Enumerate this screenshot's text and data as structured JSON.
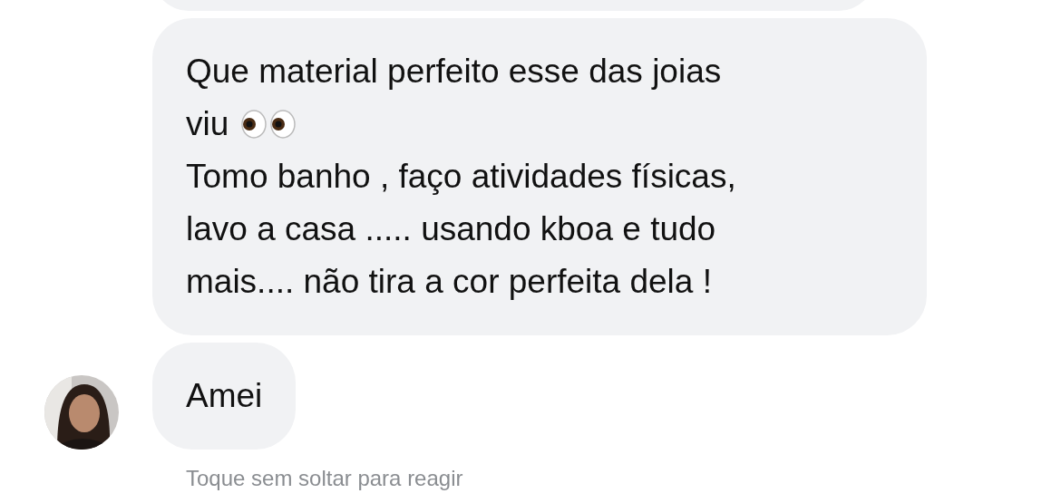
{
  "messages": [
    {
      "lines": [
        {
          "text": "Que material perfeito esse das joias"
        },
        {
          "text": "viu",
          "kind": "eyes"
        },
        {
          "text": "Tomo banho , faço atividades físicas,"
        },
        {
          "text": "lavo a casa ..... usando kboa e tudo"
        },
        {
          "text": "mais.... não tira a cor perfeita dela !"
        }
      ],
      "avatar": false
    },
    {
      "lines": [
        {
          "text": "Amei"
        }
      ],
      "avatar": true
    }
  ],
  "hint": "Toque sem soltar para reagir"
}
